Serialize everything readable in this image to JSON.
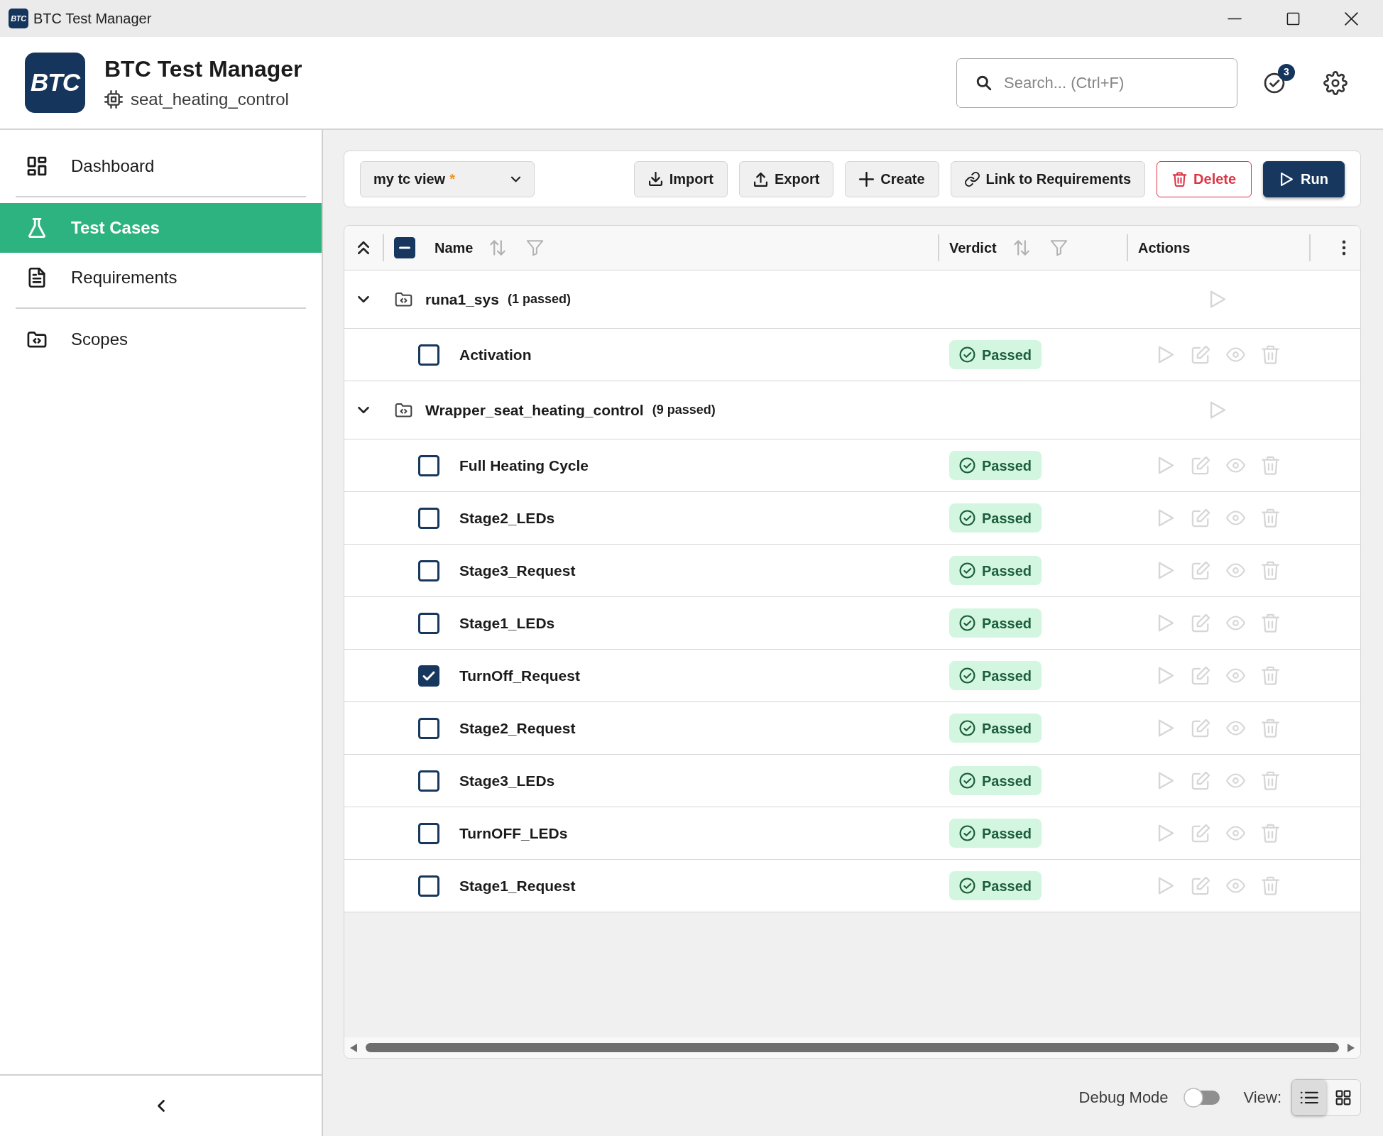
{
  "window": {
    "logo": "BTC",
    "title": "BTC Test Manager"
  },
  "header": {
    "logo": "BTC",
    "title": "BTC Test Manager",
    "project": "seat_heating_control",
    "search": {
      "placeholder": "Search... (Ctrl+F)"
    },
    "notifications": {
      "count": "3"
    }
  },
  "sidebar": {
    "sections": [
      {
        "items": [
          {
            "label": "Dashboard",
            "kind": "dashboard",
            "selected": false
          }
        ]
      },
      {
        "items": [
          {
            "label": "Test Cases",
            "kind": "tests",
            "selected": true
          },
          {
            "label": "Requirements",
            "kind": "requirements",
            "selected": false
          }
        ]
      },
      {
        "items": [
          {
            "label": "Scopes",
            "kind": "scopes",
            "selected": false
          }
        ]
      }
    ]
  },
  "toolbar": {
    "view_select": {
      "value": "my tc view",
      "unsaved_mark": "*"
    },
    "buttons": [
      {
        "label": "Import",
        "kind": "import"
      },
      {
        "label": "Export",
        "kind": "export"
      },
      {
        "label": "Create",
        "kind": "create"
      },
      {
        "label": "Link to Requirements",
        "kind": "link"
      },
      {
        "label": "Delete",
        "kind": "delete"
      },
      {
        "label": "Run",
        "kind": "run"
      }
    ]
  },
  "table": {
    "select_all": {
      "checked": false,
      "indeterminate": true
    },
    "columns": [
      {
        "label": "Name",
        "sortable": true,
        "filterable": true
      },
      {
        "label": "Verdict",
        "sortable": true,
        "filterable": true
      },
      {
        "label": "Actions",
        "sortable": false,
        "filterable": false
      }
    ],
    "group_actions": [
      {
        "kind": "run",
        "disabled": true
      }
    ],
    "row_actions": [
      {
        "kind": "run",
        "disabled": true
      },
      {
        "kind": "edit",
        "disabled": true
      },
      {
        "kind": "view",
        "disabled": true
      },
      {
        "kind": "delete",
        "disabled": true
      }
    ],
    "groups": [
      {
        "name": "runa1_sys",
        "summary": "(1 passed)",
        "expanded": true,
        "children": [
          {
            "name": "Activation",
            "checked": false,
            "verdict": {
              "label": "Passed",
              "kind": "passed"
            }
          }
        ]
      },
      {
        "name": "Wrapper_seat_heating_control",
        "summary": "(9 passed)",
        "expanded": true,
        "children": [
          {
            "name": "Full Heating Cycle",
            "checked": false,
            "verdict": {
              "label": "Passed",
              "kind": "passed"
            }
          },
          {
            "name": "Stage2_LEDs",
            "checked": false,
            "verdict": {
              "label": "Passed",
              "kind": "passed"
            }
          },
          {
            "name": "Stage3_Request",
            "checked": false,
            "verdict": {
              "label": "Passed",
              "kind": "passed"
            }
          },
          {
            "name": "Stage1_LEDs",
            "checked": false,
            "verdict": {
              "label": "Passed",
              "kind": "passed"
            }
          },
          {
            "name": "TurnOff_Request",
            "checked": true,
            "verdict": {
              "label": "Passed",
              "kind": "passed"
            }
          },
          {
            "name": "Stage2_Request",
            "checked": false,
            "verdict": {
              "label": "Passed",
              "kind": "passed"
            }
          },
          {
            "name": "Stage3_LEDs",
            "checked": false,
            "verdict": {
              "label": "Passed",
              "kind": "passed"
            }
          },
          {
            "name": "TurnOFF_LEDs",
            "checked": false,
            "verdict": {
              "label": "Passed",
              "kind": "passed"
            }
          },
          {
            "name": "Stage1_Request",
            "checked": false,
            "verdict": {
              "label": "Passed",
              "kind": "passed"
            }
          }
        ]
      }
    ]
  },
  "footer": {
    "debug_mode": {
      "label": "Debug Mode",
      "on": false
    },
    "view": {
      "label": "View:",
      "options": [
        {
          "kind": "list",
          "selected": true
        },
        {
          "kind": "grid",
          "selected": false
        }
      ]
    }
  }
}
